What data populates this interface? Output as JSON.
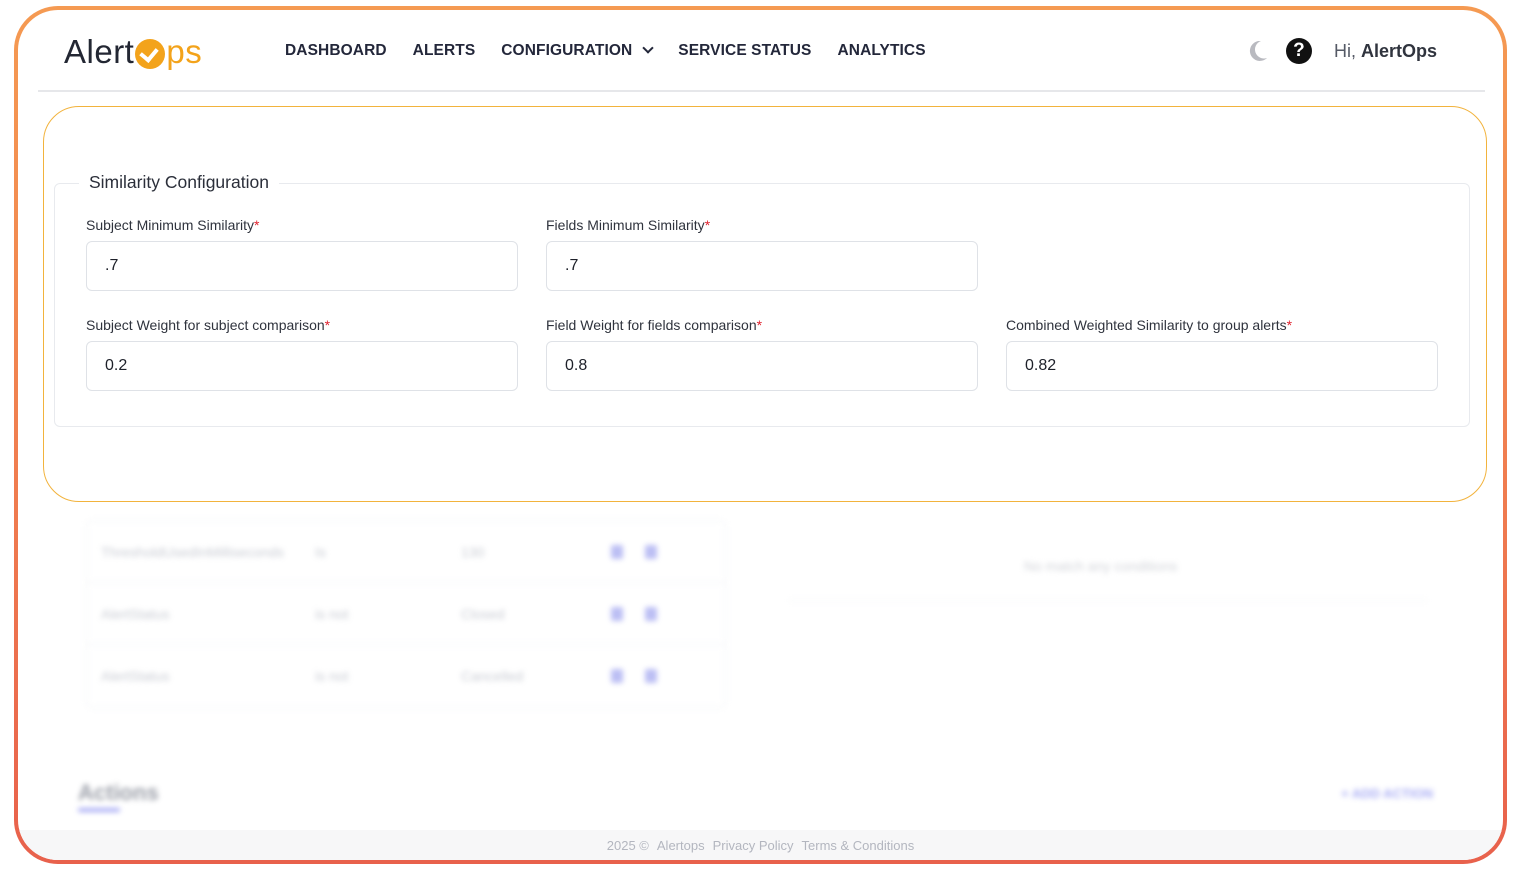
{
  "logo": {
    "part1": "Alert",
    "part2": "ps"
  },
  "nav": {
    "items": [
      {
        "label": "DASHBOARD"
      },
      {
        "label": "ALERTS"
      },
      {
        "label": "CONFIGURATION"
      },
      {
        "label": "SERVICE STATUS"
      },
      {
        "label": "ANALYTICS"
      }
    ]
  },
  "header": {
    "help_glyph": "?",
    "greeting_prefix": "Hi, ",
    "user_name": "AlertOps"
  },
  "similarity": {
    "title": "Similarity Configuration",
    "required_mark": "*",
    "fields": [
      {
        "label": "Subject Minimum Similarity",
        "value": ".7"
      },
      {
        "label": "Fields Minimum Similarity",
        "value": ".7"
      },
      {
        "label": "Subject Weight for subject comparison",
        "value": "0.2"
      },
      {
        "label": "Field Weight for fields comparison",
        "value": "0.8"
      },
      {
        "label": "Combined Weighted Similarity to group alerts",
        "value": "0.82"
      }
    ]
  },
  "background": {
    "rows": [
      {
        "c1": "ThresholdUsedInMilliseconds",
        "c2": "Is",
        "c3": "130"
      },
      {
        "c1": "AlertStatus",
        "c2": "is not",
        "c3": "Closed"
      },
      {
        "c1": "AlertStatus",
        "c2": "is not",
        "c3": "Cancelled"
      }
    ],
    "right_note": "No match any conditions",
    "actions_title": "Actions",
    "add_action": "+ ADD ACTION"
  },
  "footer": {
    "year": "2025 ©",
    "brand": "Alertops",
    "privacy": "Privacy Policy",
    "terms": "Terms & Conditions"
  },
  "colors": {
    "accent": "#f3a31b",
    "frame_top": "#f59a52",
    "frame_bottom": "#e8614c",
    "required": "#e0222e"
  }
}
